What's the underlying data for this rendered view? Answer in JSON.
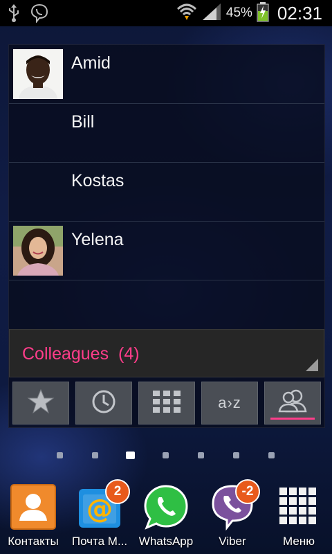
{
  "status_bar": {
    "battery_percent": "45%",
    "time": "02:31",
    "icons": [
      "usb-icon",
      "viber-notification-icon",
      "wifi-icon",
      "signal-icon",
      "battery-icon"
    ]
  },
  "contacts": [
    {
      "name": "Amid",
      "has_photo": true
    },
    {
      "name": "Bill",
      "has_photo": false
    },
    {
      "name": "Kostas",
      "has_photo": false
    },
    {
      "name": "Yelena",
      "has_photo": true
    }
  ],
  "group": {
    "label": "Colleagues",
    "count_text": "(4)"
  },
  "tabs": [
    {
      "id": "favorites",
      "icon": "star-icon"
    },
    {
      "id": "recent",
      "icon": "clock-icon"
    },
    {
      "id": "dialpad",
      "icon": "grid-icon"
    },
    {
      "id": "alphabetical",
      "icon": "a-to-z-icon",
      "label": "a›z"
    },
    {
      "id": "groups",
      "icon": "people-icon",
      "selected": true
    }
  ],
  "page_indicator": {
    "count": 7,
    "active_index": 2
  },
  "dock": [
    {
      "label": "Контакты",
      "icon": "contacts-icon"
    },
    {
      "label": "Почта М...",
      "icon": "mail-icon",
      "badge": "2"
    },
    {
      "label": "WhatsApp",
      "icon": "whatsapp-icon"
    },
    {
      "label": "Viber",
      "icon": "viber-icon",
      "badge": "-2"
    },
    {
      "label": "Меню",
      "icon": "apps-grid-icon"
    }
  ],
  "colors": {
    "accent_pink": "#ff3d8a",
    "badge_orange": "#e85a1c",
    "whatsapp_green": "#2fbf44",
    "viber_purple": "#7b519d",
    "contacts_orange": "#f08a2c",
    "mail_blue": "#1e8fe0"
  }
}
